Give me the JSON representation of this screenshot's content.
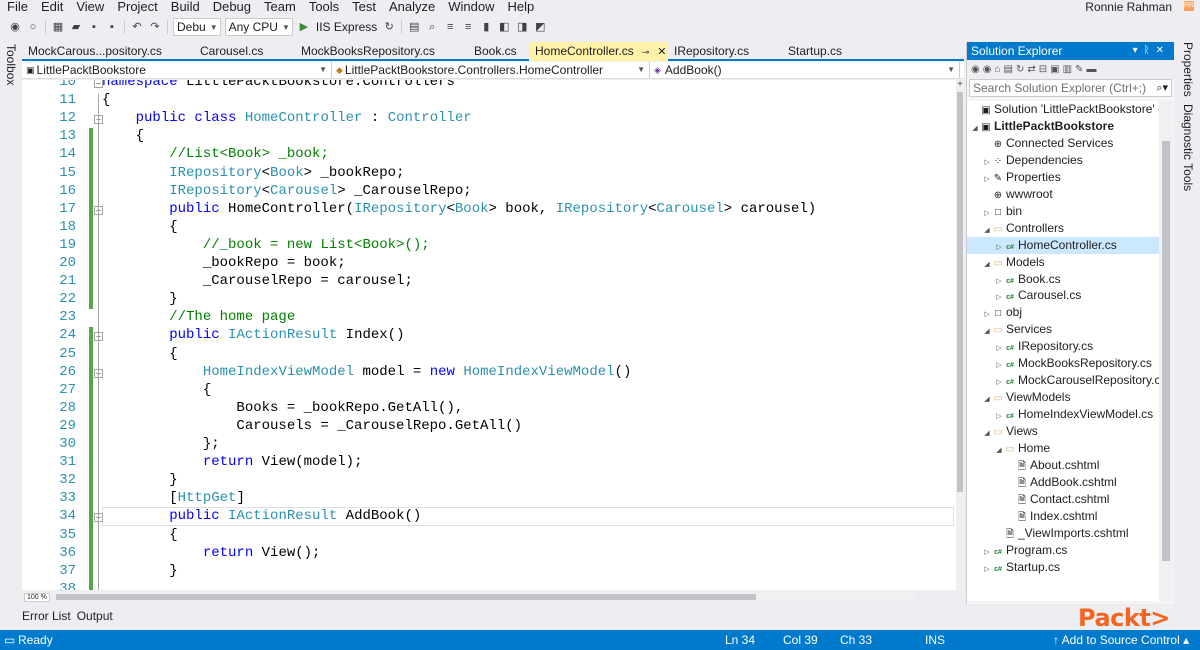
{
  "menu": [
    "File",
    "Edit",
    "View",
    "Project",
    "Build",
    "Debug",
    "Team",
    "Tools",
    "Test",
    "Analyze",
    "Window",
    "Help"
  ],
  "user": {
    "name": "Ronnie Rahman",
    "badge": "RR"
  },
  "toolbar": {
    "config": "Debu",
    "platform": "Any CPU",
    "run_target": "IIS Express"
  },
  "side": {
    "toolbox": "Toolbox",
    "properties": "Properties",
    "diagnostic": "Diagnostic Tools"
  },
  "tabs": [
    {
      "label": "MockCarous...pository.cs",
      "active": false
    },
    {
      "label": "Carousel.cs",
      "active": false
    },
    {
      "label": "MockBooksRepository.cs",
      "active": false
    },
    {
      "label": "Book.cs",
      "active": false
    },
    {
      "label": "HomeController.cs",
      "active": true
    },
    {
      "label": "IRepository.cs",
      "active": false
    },
    {
      "label": "Startup.cs",
      "active": false
    }
  ],
  "nav": {
    "project": "LittlePacktBookstore",
    "class": "LittlePacktBookstore.Controllers.HomeController",
    "member": "AddBook()"
  },
  "code": {
    "first_line": 10,
    "current_line": 34,
    "lines": [
      [
        [
          "kw",
          "namespace"
        ],
        [
          "t",
          " LittlePacktBookstore.Controllers"
        ]
      ],
      [
        [
          "t",
          "{"
        ]
      ],
      [
        [
          "t",
          "    "
        ],
        [
          "kw",
          "public class"
        ],
        [
          "t",
          " "
        ],
        [
          "ty",
          "HomeController"
        ],
        [
          "t",
          " : "
        ],
        [
          "ty",
          "Controller"
        ]
      ],
      [
        [
          "t",
          "    {"
        ]
      ],
      [
        [
          "t",
          "        "
        ],
        [
          "cm",
          "//List<Book> _book;"
        ]
      ],
      [
        [
          "t",
          "        "
        ],
        [
          "ty",
          "IRepository"
        ],
        [
          "t",
          "<"
        ],
        [
          "ty",
          "Book"
        ],
        [
          "t",
          "> _bookRepo;"
        ]
      ],
      [
        [
          "t",
          "        "
        ],
        [
          "ty",
          "IRepository"
        ],
        [
          "t",
          "<"
        ],
        [
          "ty",
          "Carousel"
        ],
        [
          "t",
          "> _CarouselRepo;"
        ]
      ],
      [
        [
          "t",
          "        "
        ],
        [
          "kw",
          "public"
        ],
        [
          "t",
          " HomeController("
        ],
        [
          "ty",
          "IRepository"
        ],
        [
          "t",
          "<"
        ],
        [
          "ty",
          "Book"
        ],
        [
          "t",
          "> book, "
        ],
        [
          "ty",
          "IRepository"
        ],
        [
          "t",
          "<"
        ],
        [
          "ty",
          "Carousel"
        ],
        [
          "t",
          "> carousel)"
        ]
      ],
      [
        [
          "t",
          "        {"
        ]
      ],
      [
        [
          "t",
          "            "
        ],
        [
          "cm",
          "//_book = new List<Book>();"
        ]
      ],
      [
        [
          "t",
          "            _bookRepo = book;"
        ]
      ],
      [
        [
          "t",
          "            _CarouselRepo = carousel;"
        ]
      ],
      [
        [
          "t",
          "        }"
        ]
      ],
      [
        [
          "t",
          "        "
        ],
        [
          "cm",
          "//The home page"
        ]
      ],
      [
        [
          "t",
          "        "
        ],
        [
          "kw",
          "public"
        ],
        [
          "t",
          " "
        ],
        [
          "ty",
          "IActionResult"
        ],
        [
          "t",
          " Index()"
        ]
      ],
      [
        [
          "t",
          "        {"
        ]
      ],
      [
        [
          "t",
          "            "
        ],
        [
          "ty",
          "HomeIndexViewModel"
        ],
        [
          "t",
          " model = "
        ],
        [
          "kw",
          "new"
        ],
        [
          "t",
          " "
        ],
        [
          "ty",
          "HomeIndexViewModel"
        ],
        [
          "t",
          "()"
        ]
      ],
      [
        [
          "t",
          "            {"
        ]
      ],
      [
        [
          "t",
          "                Books = _bookRepo.GetAll(),"
        ]
      ],
      [
        [
          "t",
          "                Carousels = _CarouselRepo.GetAll()"
        ]
      ],
      [
        [
          "t",
          "            };"
        ]
      ],
      [
        [
          "t",
          "            "
        ],
        [
          "kw",
          "return"
        ],
        [
          "t",
          " View(model);"
        ]
      ],
      [
        [
          "t",
          "        }"
        ]
      ],
      [
        [
          "t",
          "        ["
        ],
        [
          "ty",
          "HttpGet"
        ],
        [
          "t",
          "]"
        ]
      ],
      [
        [
          "t",
          "        "
        ],
        [
          "kw",
          "public"
        ],
        [
          "t",
          " "
        ],
        [
          "ty",
          "IActionResult"
        ],
        [
          "t",
          " AddBook()"
        ]
      ],
      [
        [
          "t",
          "        {"
        ]
      ],
      [
        [
          "t",
          "            "
        ],
        [
          "kw",
          "return"
        ],
        [
          "t",
          " View();"
        ]
      ],
      [
        [
          "t",
          "        }"
        ]
      ],
      [
        [
          "t",
          ""
        ]
      ]
    ]
  },
  "zoom": "100 %",
  "tool_tabs": [
    "Error List",
    "Output"
  ],
  "solution_explorer": {
    "title": "Solution Explorer",
    "search_placeholder": "Search Solution Explorer (Ctrl+;)",
    "items": [
      {
        "depth": 0,
        "toggle": "",
        "icon": "▣",
        "label": "Solution 'LittlePacktBookstore' (1 pr",
        "bold": false
      },
      {
        "depth": 0,
        "toggle": "◢",
        "icon": "▣",
        "label": "LittlePacktBookstore",
        "bold": true
      },
      {
        "depth": 1,
        "toggle": "",
        "icon": "⊕",
        "label": "Connected Services",
        "bold": false
      },
      {
        "depth": 1,
        "toggle": "▷",
        "icon": "⁘",
        "label": "Dependencies",
        "bold": false
      },
      {
        "depth": 1,
        "toggle": "▷",
        "icon": "✎",
        "label": "Properties",
        "bold": false
      },
      {
        "depth": 1,
        "toggle": "",
        "icon": "⊕",
        "label": "wwwroot",
        "bold": false
      },
      {
        "depth": 1,
        "toggle": "▷",
        "icon": "□",
        "label": "bin",
        "bold": false
      },
      {
        "depth": 1,
        "toggle": "◢",
        "icon": "▭",
        "label": "Controllers",
        "bold": false
      },
      {
        "depth": 2,
        "toggle": "▷",
        "icon": "c#",
        "label": "HomeController.cs",
        "bold": false,
        "selected": true
      },
      {
        "depth": 1,
        "toggle": "◢",
        "icon": "▭",
        "label": "Models",
        "bold": false
      },
      {
        "depth": 2,
        "toggle": "▷",
        "icon": "c#",
        "label": "Book.cs",
        "bold": false
      },
      {
        "depth": 2,
        "toggle": "▷",
        "icon": "c#",
        "label": "Carousel.cs",
        "bold": false
      },
      {
        "depth": 1,
        "toggle": "▷",
        "icon": "□",
        "label": "obj",
        "bold": false
      },
      {
        "depth": 1,
        "toggle": "◢",
        "icon": "▭",
        "label": "Services",
        "bold": false
      },
      {
        "depth": 2,
        "toggle": "▷",
        "icon": "c#",
        "label": "IRepository.cs",
        "bold": false
      },
      {
        "depth": 2,
        "toggle": "▷",
        "icon": "c#",
        "label": "MockBooksRepository.cs",
        "bold": false
      },
      {
        "depth": 2,
        "toggle": "▷",
        "icon": "c#",
        "label": "MockCarouselRepository.cs",
        "bold": false
      },
      {
        "depth": 1,
        "toggle": "◢",
        "icon": "▭",
        "label": "ViewModels",
        "bold": false
      },
      {
        "depth": 2,
        "toggle": "▷",
        "icon": "c#",
        "label": "HomeIndexViewModel.cs",
        "bold": false
      },
      {
        "depth": 1,
        "toggle": "◢",
        "icon": "▭",
        "label": "Views",
        "bold": false
      },
      {
        "depth": 2,
        "toggle": "◢",
        "icon": "▭",
        "label": "Home",
        "bold": false
      },
      {
        "depth": 3,
        "toggle": "",
        "icon": "🗎",
        "label": "About.cshtml",
        "bold": false
      },
      {
        "depth": 3,
        "toggle": "",
        "icon": "🗎",
        "label": "AddBook.cshtml",
        "bold": false
      },
      {
        "depth": 3,
        "toggle": "",
        "icon": "🗎",
        "label": "Contact.cshtml",
        "bold": false
      },
      {
        "depth": 3,
        "toggle": "",
        "icon": "🗎",
        "label": "Index.cshtml",
        "bold": false
      },
      {
        "depth": 2,
        "toggle": "",
        "icon": "🗎",
        "label": "_ViewImports.cshtml",
        "bold": false
      },
      {
        "depth": 1,
        "toggle": "▷",
        "icon": "c#",
        "label": "Program.cs",
        "bold": false
      },
      {
        "depth": 1,
        "toggle": "▷",
        "icon": "c#",
        "label": "Startup.cs",
        "bold": false
      }
    ]
  },
  "status": {
    "state": "Ready",
    "ln": "Ln 34",
    "col": "Col 39",
    "ch": "Ch 33",
    "mode": "INS",
    "source_control": "↑ Add to Source Control ▴"
  },
  "watermark": "Packt>",
  "colors": {
    "accent": "#007acc",
    "active_tab": "#fff1a8",
    "keyword": "#0000ff",
    "type": "#2b91af",
    "comment": "#008000",
    "watermark": "#f26522"
  }
}
